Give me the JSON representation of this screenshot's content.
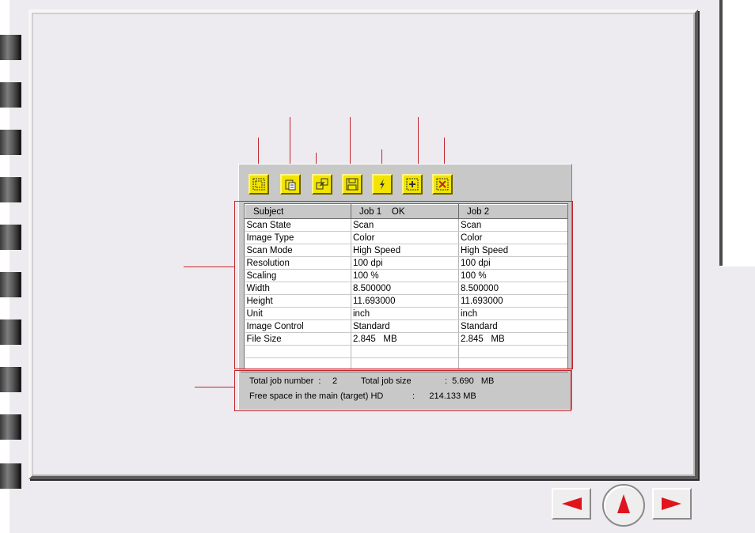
{
  "toolbar": {
    "buttons": [
      {
        "name": "select-all-icon"
      },
      {
        "name": "clipboard-icon"
      },
      {
        "name": "open-folder-icon"
      },
      {
        "name": "save-disk-icon"
      },
      {
        "name": "lightning-icon"
      },
      {
        "name": "add-icon"
      },
      {
        "name": "delete-icon"
      }
    ]
  },
  "table": {
    "headers": [
      "Subject",
      "Job 1    OK",
      "Job 2"
    ],
    "rows": [
      [
        "Scan State",
        "Scan",
        "Scan"
      ],
      [
        "Image Type",
        "Color",
        "Color"
      ],
      [
        "Scan Mode",
        "High Speed",
        "High Speed"
      ],
      [
        "Resolution",
        "100 dpi",
        "100 dpi"
      ],
      [
        "Scaling",
        "100 %",
        "100 %"
      ],
      [
        "Width",
        "8.500000",
        "8.500000"
      ],
      [
        "Height",
        "11.693000",
        "11.693000"
      ],
      [
        "Unit",
        "inch",
        "inch"
      ],
      [
        "Image Control",
        "Standard",
        "Standard"
      ],
      [
        "File Size",
        "2.845   MB",
        "2.845   MB"
      ],
      [
        "",
        "",
        ""
      ],
      [
        "",
        "",
        ""
      ]
    ]
  },
  "status": {
    "total_job_label": "Total job number  :",
    "total_job_value": "2",
    "total_size_label": "Total job size",
    "total_size_value": ":  5.690   MB",
    "free_space_label": "Free space in the main (target) HD",
    "free_space_value": ":      214.133 MB"
  },
  "colors": {
    "callout": "#c0272d",
    "toolbar_button": "#f2e400",
    "nav_arrow": "#e0141e"
  },
  "nav": {
    "prev": "triangle-left-icon",
    "up": "triangle-up-icon",
    "next": "triangle-right-icon"
  }
}
